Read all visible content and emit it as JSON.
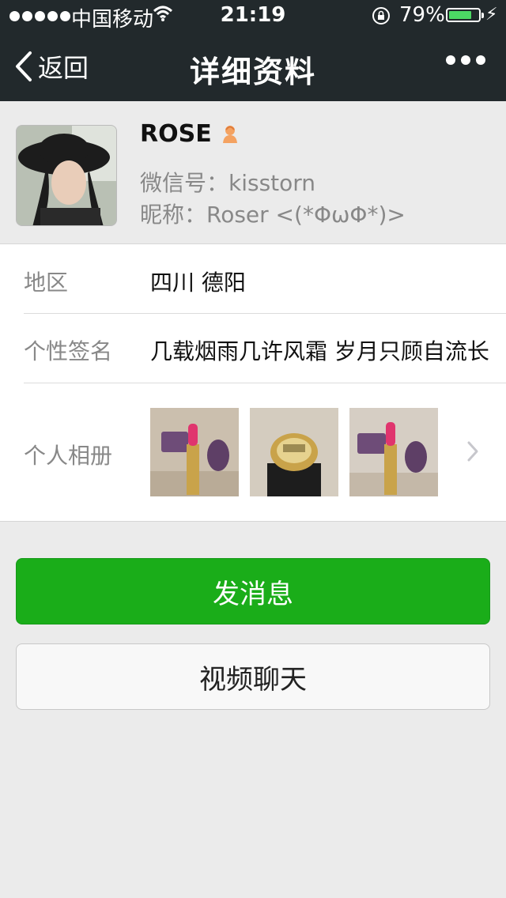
{
  "status_bar": {
    "carrier": "中国移动",
    "time": "21:19",
    "battery": "79%",
    "battery_level": 0.79,
    "battery_color": "#4cd964"
  },
  "nav": {
    "back_label": "返回",
    "title": "详细资料",
    "more_icon": "more-dots-icon"
  },
  "profile": {
    "name": "ROSE",
    "gender_icon": "female-icon",
    "wechat_id": "微信号：kisstorn",
    "nickname": "昵称：Roser <(*ΦωΦ*)>"
  },
  "info": {
    "region_label": "地区",
    "region_value": "四川 德阳",
    "signature_label": "个性签名",
    "signature_value": "几载烟雨几许风霜 岁月只顾自流长",
    "album_label": "个人相册"
  },
  "actions": {
    "message_label": "发消息",
    "video_label": "视频聊天"
  },
  "colors": {
    "nav_bg": "#22292c",
    "primary_green": "#1aad19",
    "page_bg": "#ebebeb"
  }
}
